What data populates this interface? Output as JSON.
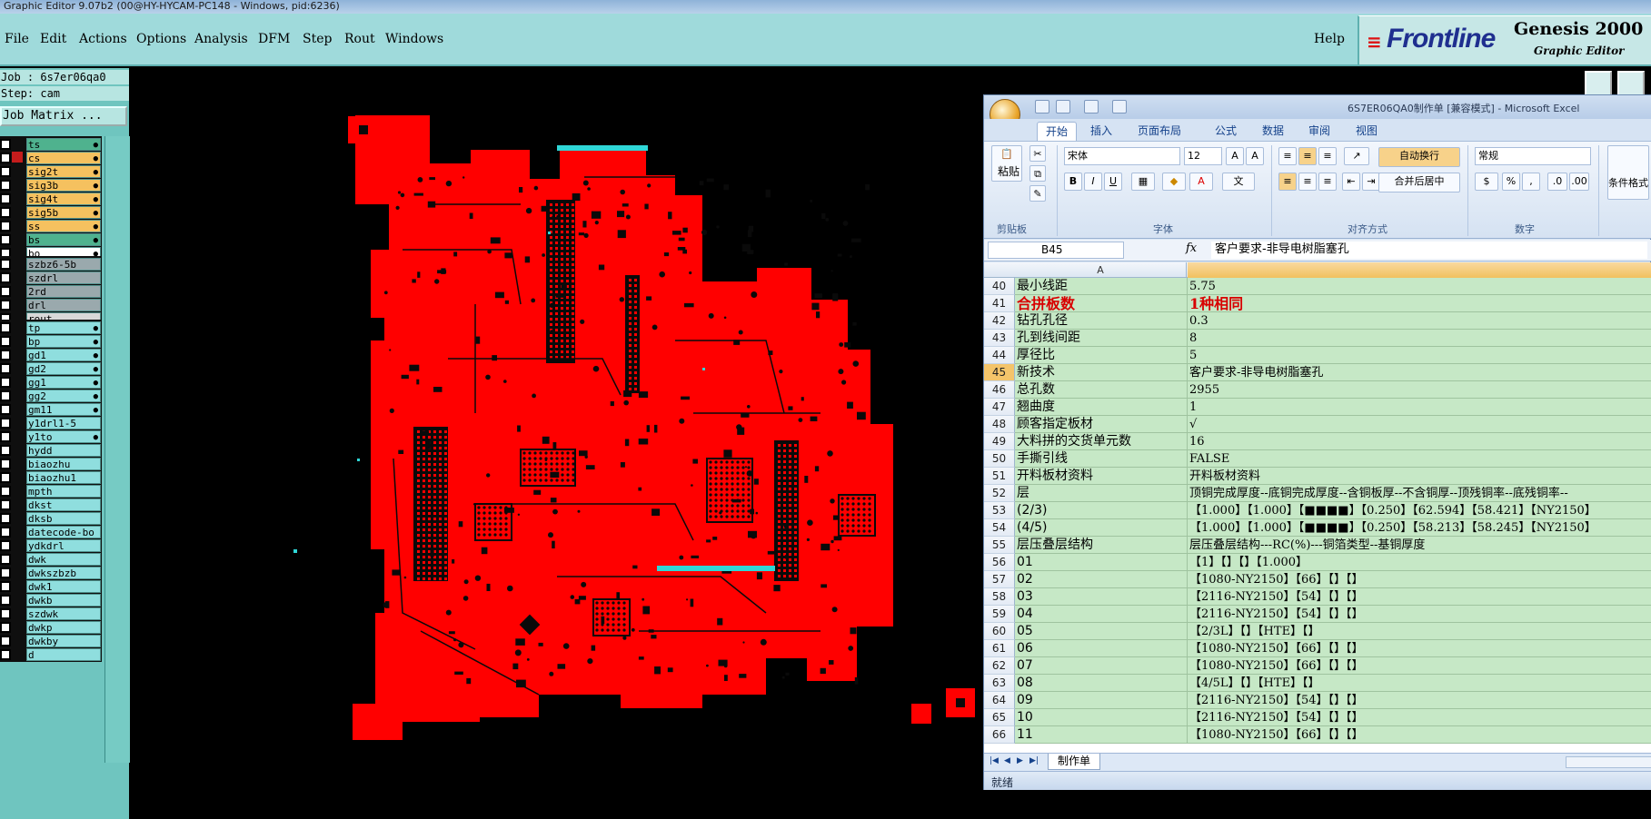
{
  "window": {
    "title": "Graphic Editor 9.07b2 (00@HY-HYCAM-PC148 - Windows, pid:6236)"
  },
  "menu": {
    "items": [
      "File",
      "Edit",
      "Actions",
      "Options",
      "Analysis",
      "DFM",
      "Step",
      "Rout",
      "Windows"
    ],
    "help": "Help"
  },
  "brand": {
    "logo": "Frontline",
    "product": "Genesis 2000",
    "subtitle": "Graphic Editor"
  },
  "job": {
    "job_line": "Job : 6s7er06qa0",
    "step_line": "Step: cam",
    "matrix_button": "Job Matrix ..."
  },
  "layers": {
    "group1": [
      {
        "name": "ts",
        "color": "#4fb28e",
        "mark": "●"
      },
      {
        "name": "cs",
        "color": "#f5c15f",
        "mark": "●",
        "active": true
      },
      {
        "name": "sig2t",
        "color": "#f5c15f",
        "mark": "●"
      },
      {
        "name": "sig3b",
        "color": "#f5c15f",
        "mark": "●"
      },
      {
        "name": "sig4t",
        "color": "#f5c15f",
        "mark": "●"
      },
      {
        "name": "sig5b",
        "color": "#f5c15f",
        "mark": "●"
      },
      {
        "name": "ss",
        "color": "#f5c15f",
        "mark": "●"
      },
      {
        "name": "bs",
        "color": "#4fb28e",
        "mark": "●"
      },
      {
        "name": "bo",
        "color": "#ffffff",
        "mark": "●"
      }
    ],
    "group2": [
      {
        "name": "szbz6-5b",
        "color": "#9aa9ad"
      },
      {
        "name": "szdrl",
        "color": "#9aa9ad"
      },
      {
        "name": "2rd",
        "color": "#9aa9ad"
      },
      {
        "name": "drl",
        "color": "#9aa9ad"
      },
      {
        "name": "rout",
        "color": "#d8d8d8"
      }
    ],
    "group3": [
      {
        "name": "tp",
        "color": "#8fdede",
        "mark": "●"
      },
      {
        "name": "bp",
        "color": "#8fdede",
        "mark": "●"
      },
      {
        "name": "gd1",
        "color": "#8fdede",
        "mark": "●"
      },
      {
        "name": "gd2",
        "color": "#8fdede",
        "mark": "●"
      },
      {
        "name": "gg1",
        "color": "#8fdede",
        "mark": "●"
      },
      {
        "name": "gg2",
        "color": "#8fdede",
        "mark": "●"
      },
      {
        "name": "gm11",
        "color": "#8fdede",
        "mark": "●"
      },
      {
        "name": "y1drl1-5",
        "color": "#8fdede"
      },
      {
        "name": "y1to",
        "color": "#8fdede",
        "mark": "●"
      },
      {
        "name": "hydd",
        "color": "#8fdede"
      },
      {
        "name": "biaozhu",
        "color": "#8fdede"
      },
      {
        "name": "biaozhu1",
        "color": "#8fdede"
      },
      {
        "name": "mpth",
        "color": "#8fdede"
      },
      {
        "name": "dkst",
        "color": "#8fdede"
      },
      {
        "name": "dksb",
        "color": "#8fdede"
      },
      {
        "name": "datecode-bo",
        "color": "#8fdede"
      },
      {
        "name": "ydkdrl",
        "color": "#8fdede"
      },
      {
        "name": "dwk",
        "color": "#8fdede"
      },
      {
        "name": "dwkszbzb",
        "color": "#8fdede"
      },
      {
        "name": "dwk1",
        "color": "#8fdede"
      },
      {
        "name": "dwkb",
        "color": "#8fdede"
      },
      {
        "name": "szdwk",
        "color": "#8fdede"
      },
      {
        "name": "dwkp",
        "color": "#8fdede"
      },
      {
        "name": "dwkby",
        "color": "#8fdede"
      },
      {
        "name": "d",
        "color": "#8fdede"
      }
    ]
  },
  "colors": {
    "pcb_copper": "#ff0000",
    "pcb_feature": "#0a0a0a",
    "pcb_highlight": "#2fd6d6",
    "menu_bg": "#9fdadb",
    "excel_cell": "#c6e8c6"
  },
  "excel": {
    "title": "6S7ER06QA0制作单 [兼容模式] - Microsoft Excel",
    "tabs": [
      "开始",
      "插入",
      "页面布局",
      "公式",
      "数据",
      "审阅",
      "视图"
    ],
    "ribbon": {
      "paste": "粘贴",
      "groups": [
        "剪贴板",
        "字体",
        "对齐方式",
        "数字"
      ],
      "font_name": "宋体",
      "font_size": "12",
      "wrap_text": "自动换行",
      "merge_center": "合并后居中",
      "number_format": "常规",
      "cond_format": "条件格式"
    },
    "name_box": "B45",
    "fx": "fx",
    "formula": "客户要求-非导电树脂塞孔",
    "col_a": "A",
    "rows": [
      {
        "n": "40",
        "a": "最小线距",
        "b": "5.75"
      },
      {
        "n": "41",
        "a": "合拼板数",
        "b": "1种相同",
        "big": true
      },
      {
        "n": "42",
        "a": "钻孔孔径",
        "b": "0.3"
      },
      {
        "n": "43",
        "a": "孔到线间距",
        "b": "8"
      },
      {
        "n": "44",
        "a": "厚径比",
        "b": "5"
      },
      {
        "n": "45",
        "a": "新技术",
        "b": "客户要求-非导电树脂塞孔",
        "sel": true
      },
      {
        "n": "46",
        "a": "总孔数",
        "b": "2955"
      },
      {
        "n": "47",
        "a": "翘曲度",
        "b": "1"
      },
      {
        "n": "48",
        "a": "顾客指定板材",
        "b": "√"
      },
      {
        "n": "49",
        "a": "大料拼的交货单元数",
        "b": "16"
      },
      {
        "n": "50",
        "a": "手撕引线",
        "b": "FALSE"
      },
      {
        "n": "51",
        "a": "开料板材资料",
        "b": "开料板材资料"
      },
      {
        "n": "52",
        "a": "层",
        "b": "顶铜完成厚度--底铜完成厚度--含铜板厚--不含铜厚--顶残铜率--底残铜率--"
      },
      {
        "n": "53",
        "a": "(2/3)",
        "b": "【1.000】【1.000】【■■■■】【0.250】【62.594】【58.421】【NY2150】"
      },
      {
        "n": "54",
        "a": "(4/5)",
        "b": "【1.000】【1.000】【■■■■】【0.250】【58.213】【58.245】【NY2150】"
      },
      {
        "n": "55",
        "a": "层压叠层结构",
        "b": "层压叠层结构---RC(%)---铜箔类型--基铜厚度"
      },
      {
        "n": "56",
        "a": "01",
        "b": "【1】【】【】【1.000】"
      },
      {
        "n": "57",
        "a": "02",
        "b": "【1080-NY2150】【66】【】【】"
      },
      {
        "n": "58",
        "a": "03",
        "b": "【2116-NY2150】【54】【】【】"
      },
      {
        "n": "59",
        "a": "04",
        "b": "【2116-NY2150】【54】【】【】"
      },
      {
        "n": "60",
        "a": "05",
        "b": "【2/3L】【】【HTE】【】"
      },
      {
        "n": "61",
        "a": "06",
        "b": "【1080-NY2150】【66】【】【】"
      },
      {
        "n": "62",
        "a": "07",
        "b": "【1080-NY2150】【66】【】【】"
      },
      {
        "n": "63",
        "a": "08",
        "b": "【4/5L】【】【HTE】【】"
      },
      {
        "n": "64",
        "a": "09",
        "b": "【2116-NY2150】【54】【】【】"
      },
      {
        "n": "65",
        "a": "10",
        "b": "【2116-NY2150】【54】【】【】"
      },
      {
        "n": "66",
        "a": "11",
        "b": "【1080-NY2150】【66】【】【】"
      }
    ],
    "sheet_tab": "制作单",
    "status": "就绪"
  }
}
